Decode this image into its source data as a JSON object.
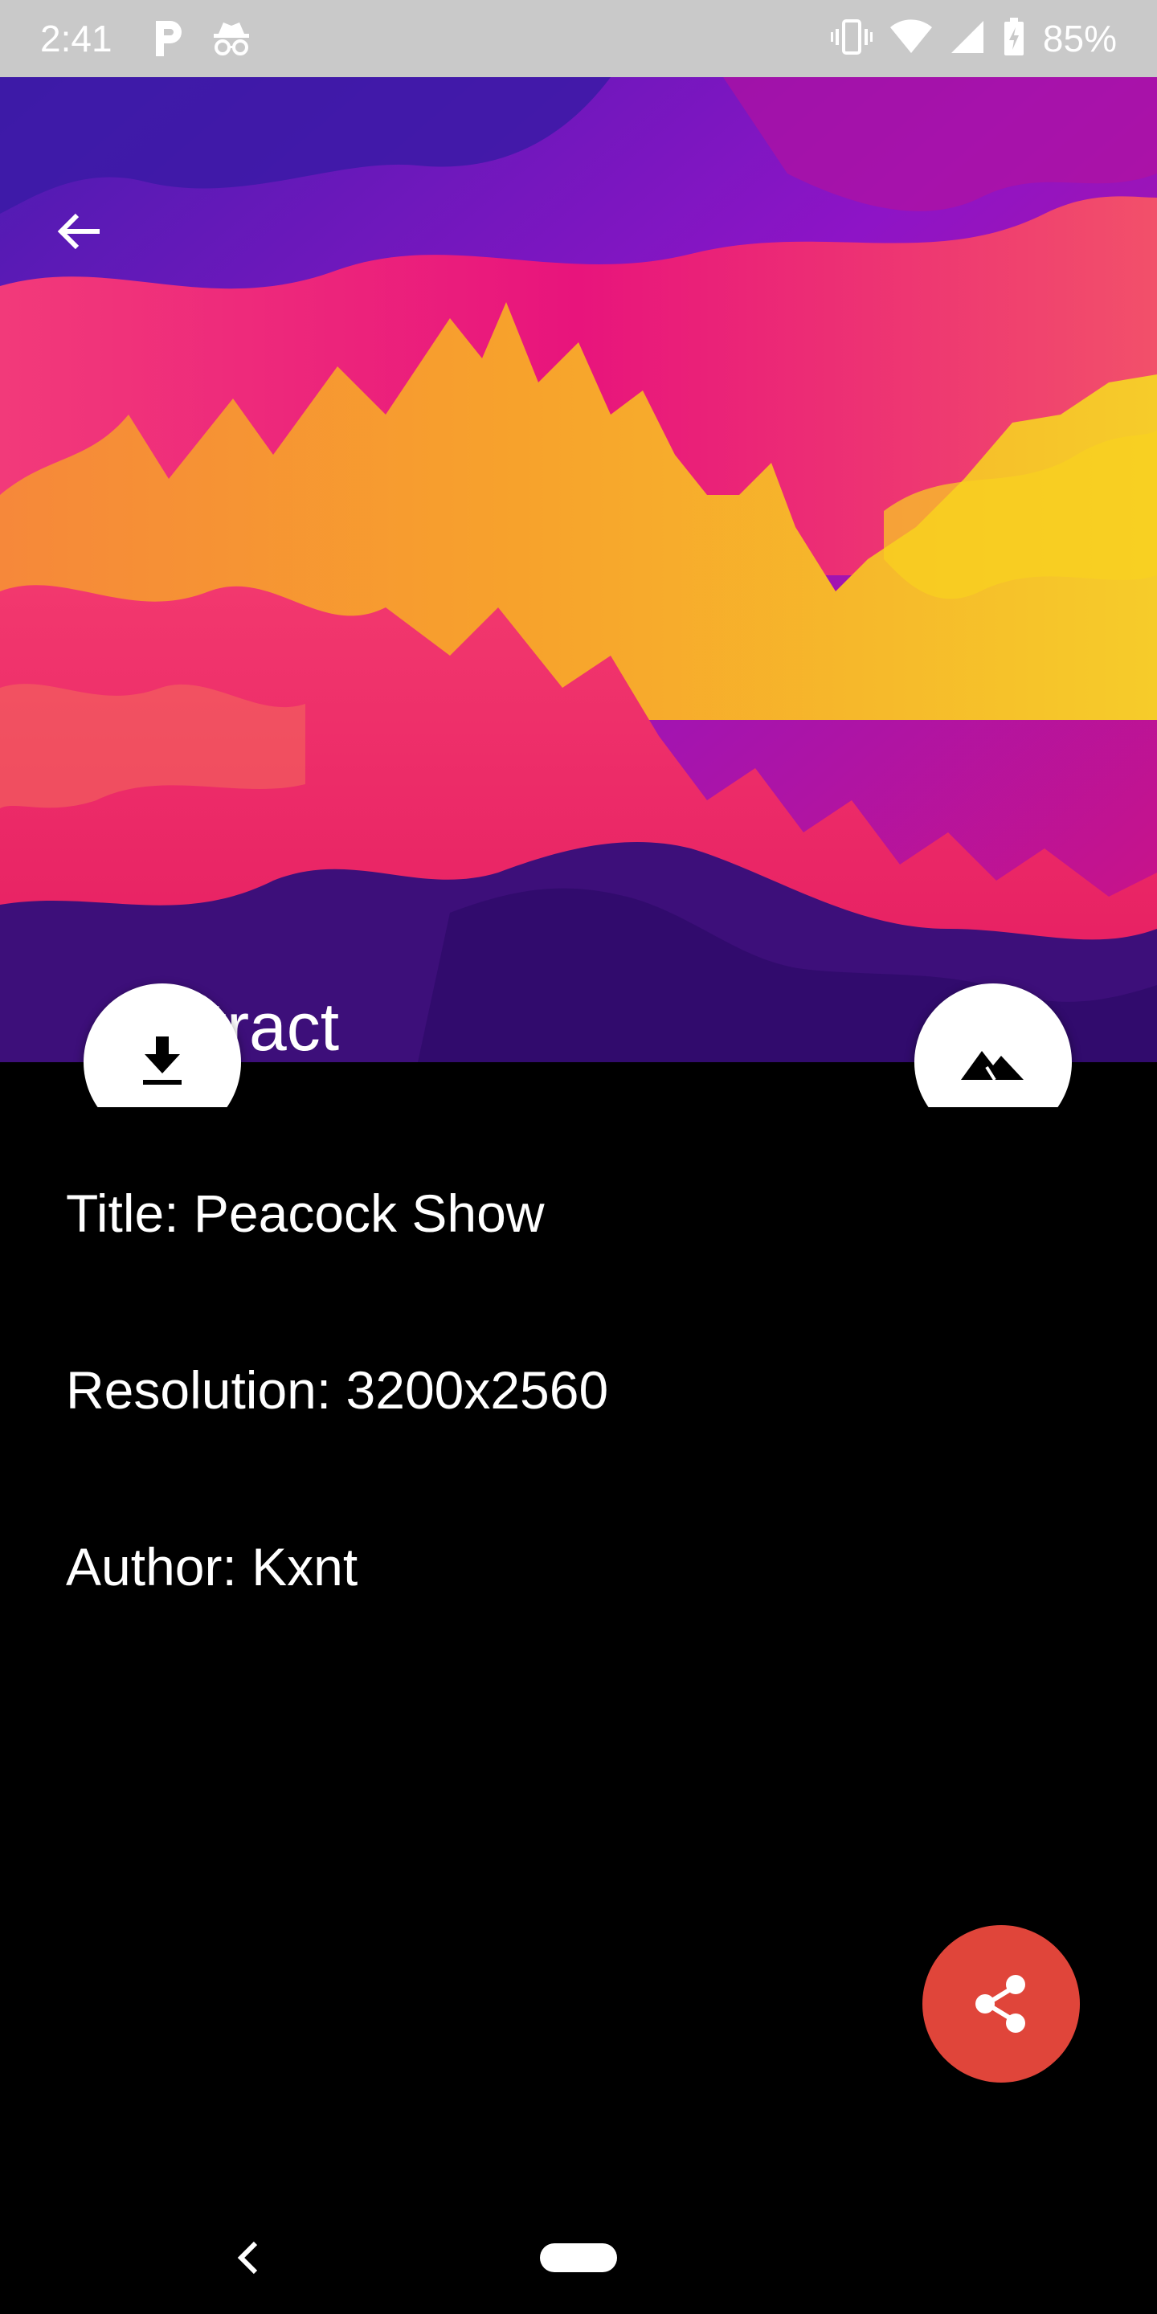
{
  "status_bar": {
    "time": "2:41",
    "battery_percent": "85%",
    "left_icons": [
      "parking-icon",
      "incognito-icon"
    ],
    "right_icons": [
      "vibrate-icon",
      "wifi-icon",
      "cell-signal-icon",
      "battery-charging-icon"
    ]
  },
  "hero": {
    "category": "Abstract",
    "back_icon": "arrow-back-icon",
    "colors": [
      "#3a1aa8",
      "#8a13c9",
      "#e0157a",
      "#f4436a",
      "#f79b2e",
      "#f6cf27",
      "#3d0f7a"
    ]
  },
  "actions": {
    "download_icon": "download-icon",
    "set_wallpaper_icon": "landscape-icon",
    "share_icon": "share-icon",
    "share_color": "#e0453a"
  },
  "details": {
    "title": "Title: Peacock Show",
    "resolution": "Resolution: 3200x2560",
    "author": "Author: Kxnt"
  },
  "nav_bar": {
    "back_icon": "chevron-left-icon",
    "home_icon": "home-pill-icon"
  }
}
